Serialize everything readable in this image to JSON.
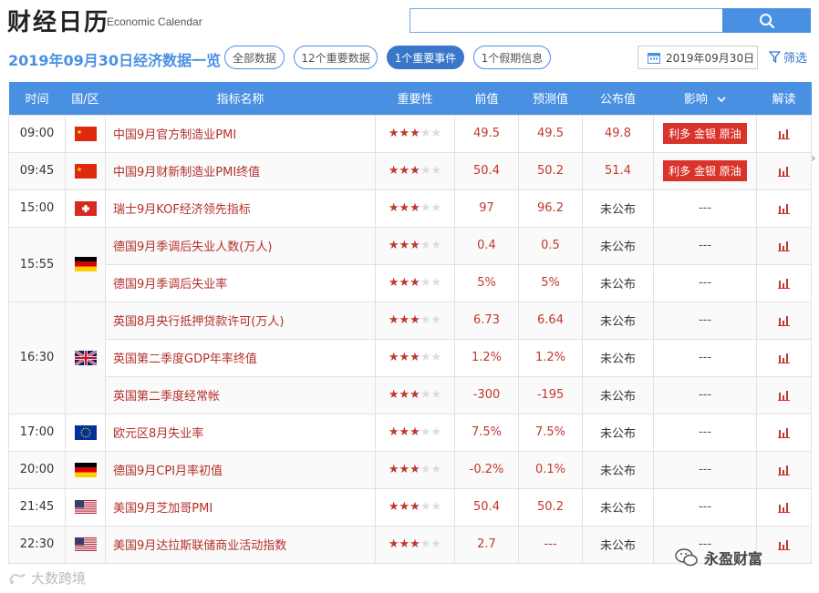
{
  "header": {
    "title_cn": "财经日历",
    "title_en": "Economic Calendar",
    "search_placeholder": ""
  },
  "subbar": {
    "title": "2019年09月30日经济数据一览",
    "pills": [
      {
        "label": "全部数据",
        "active": false
      },
      {
        "label": "12个重要数据",
        "active": false
      },
      {
        "label": "1个重要事件",
        "active": true
      },
      {
        "label": "1个假期信息",
        "active": false
      }
    ],
    "date": "2019年09月30日",
    "filter_label": "筛选"
  },
  "table": {
    "headers": [
      "时间",
      "国/区",
      "指标名称",
      "重要性",
      "前值",
      "预测值",
      "公布值",
      "影响",
      "解读"
    ],
    "groups": [
      {
        "time": "09:00",
        "flag": "cn",
        "rows": [
          {
            "name": "中国9月官方制造业PMI",
            "stars": 3,
            "prev": "49.5",
            "forecast": "49.5",
            "actual": "49.8",
            "impact": "利多 金银 原油"
          }
        ]
      },
      {
        "time": "09:45",
        "flag": "cn",
        "rows": [
          {
            "name": "中国9月财新制造业PMI终值",
            "stars": 3,
            "prev": "50.4",
            "forecast": "50.2",
            "actual": "51.4",
            "impact": "利多 金银 原油"
          }
        ]
      },
      {
        "time": "15:00",
        "flag": "ch",
        "rows": [
          {
            "name": "瑞士9月KOF经济领先指标",
            "stars": 3,
            "prev": "97",
            "forecast": "96.2",
            "actual": "未公布",
            "impact": "---"
          }
        ]
      },
      {
        "time": "15:55",
        "flag": "de",
        "rows": [
          {
            "name": "德国9月季调后失业人数(万人)",
            "stars": 3,
            "prev": "0.4",
            "forecast": "0.5",
            "actual": "未公布",
            "impact": "---"
          },
          {
            "name": "德国9月季调后失业率",
            "stars": 3,
            "prev": "5%",
            "forecast": "5%",
            "actual": "未公布",
            "impact": "---"
          }
        ]
      },
      {
        "time": "16:30",
        "flag": "gb",
        "rows": [
          {
            "name": "英国8月央行抵押贷款许可(万人)",
            "stars": 3,
            "prev": "6.73",
            "forecast": "6.64",
            "actual": "未公布",
            "impact": "---"
          },
          {
            "name": "英国第二季度GDP年率终值",
            "stars": 3,
            "prev": "1.2%",
            "forecast": "1.2%",
            "actual": "未公布",
            "impact": "---"
          },
          {
            "name": "英国第二季度经常帐",
            "stars": 3,
            "prev": "-300",
            "forecast": "-195",
            "actual": "未公布",
            "impact": "---"
          }
        ]
      },
      {
        "time": "17:00",
        "flag": "eu",
        "rows": [
          {
            "name": "欧元区8月失业率",
            "stars": 3,
            "prev": "7.5%",
            "forecast": "7.5%",
            "actual": "未公布",
            "impact": "---"
          }
        ]
      },
      {
        "time": "20:00",
        "flag": "de",
        "rows": [
          {
            "name": "德国9月CPI月率初值",
            "stars": 3,
            "prev": "-0.2%",
            "forecast": "0.1%",
            "actual": "未公布",
            "impact": "---"
          }
        ]
      },
      {
        "time": "21:45",
        "flag": "us",
        "rows": [
          {
            "name": "美国9月芝加哥PMI",
            "stars": 3,
            "prev": "50.4",
            "forecast": "50.2",
            "actual": "未公布",
            "impact": "---"
          }
        ]
      },
      {
        "time": "22:30",
        "flag": "us",
        "rows": [
          {
            "name": "美国9月达拉斯联储商业活动指数",
            "stars": 3,
            "prev": "2.7",
            "forecast": "---",
            "actual": "未公布",
            "impact": "---"
          }
        ]
      }
    ]
  },
  "watermarks": {
    "left": "大数跨境",
    "right": "永盈财富"
  },
  "colors": {
    "accent": "#4a90e2",
    "red": "#c0392b",
    "impact_bg": "#d9342b"
  }
}
